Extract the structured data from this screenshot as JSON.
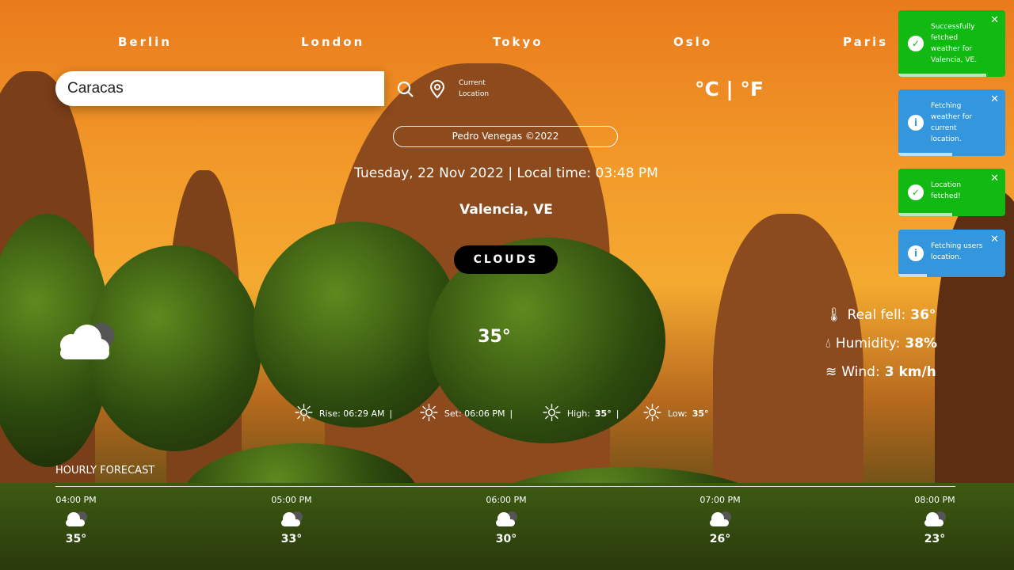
{
  "cities": [
    "Berlin",
    "London",
    "Tokyo",
    "Oslo",
    "Paris"
  ],
  "search": {
    "value": "Caracas",
    "current_location_label": "Current Location"
  },
  "units": "°C | °F",
  "credit": "Pedro Venegas ©2022",
  "date_line": "Tuesday, 22 Nov 2022 | Local time: 03:48 PM",
  "location": "Valencia, VE",
  "condition": "CLOUDS",
  "temperature": "35°",
  "details": {
    "real_feel_label": "Real fell:",
    "real_feel": "36°",
    "humidity_label": "Humidity:",
    "humidity": "38%",
    "wind_label": "Wind:",
    "wind": "3 km/h"
  },
  "sun": {
    "rise": "Rise: 06:29 AM",
    "set": "Set: 06:06 PM",
    "high_label": "High:",
    "high": "35°",
    "low_label": "Low:",
    "low": "35°",
    "sep": "|"
  },
  "hourly": {
    "title": "HOURLY FORECAST",
    "items": [
      {
        "time": "04:00 PM",
        "temp": "35°"
      },
      {
        "time": "05:00 PM",
        "temp": "33°"
      },
      {
        "time": "06:00 PM",
        "temp": "30°"
      },
      {
        "time": "07:00 PM",
        "temp": "26°"
      },
      {
        "time": "08:00 PM",
        "temp": "23°"
      }
    ]
  },
  "toasts": [
    {
      "type": "success",
      "text": "Successfully fetched weather for Valencia, VE.",
      "progress": 0.82
    },
    {
      "type": "info",
      "text": "Fetching weather for current location.",
      "progress": 0.5
    },
    {
      "type": "success",
      "text": "Location fetched!",
      "progress": 0.5
    },
    {
      "type": "info",
      "text": "Fetching users location.",
      "progress": 0.27
    }
  ],
  "colors": {
    "success": "#11b912",
    "info": "#3497dd"
  }
}
